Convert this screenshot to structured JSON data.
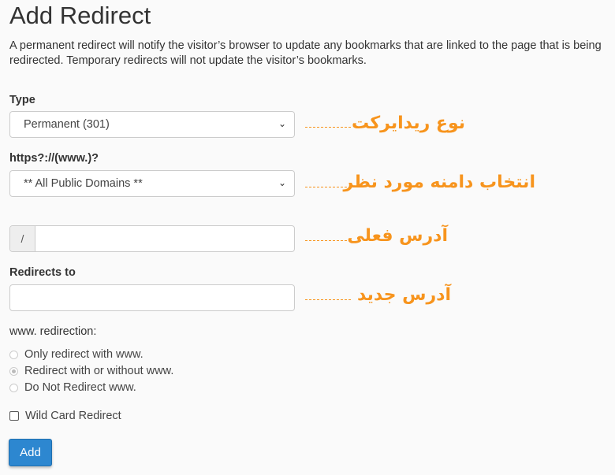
{
  "title": "Add Redirect",
  "description": "A permanent redirect will notify the visitor’s browser to update any bookmarks that are linked to the page that is being redirected. Temporary redirects will not update the visitor’s bookmarks.",
  "type": {
    "label": "Type",
    "value": "Permanent (301)"
  },
  "domain": {
    "label": "https?://(www.)?",
    "value": "** All Public Domains **"
  },
  "path": {
    "prefix": "/",
    "value": ""
  },
  "redirects_to": {
    "label": "Redirects to",
    "value": ""
  },
  "www_redirection": {
    "label": "www. redirection:",
    "options": [
      {
        "label": "Only redirect with www.",
        "selected": false
      },
      {
        "label": "Redirect with or without www.",
        "selected": true
      },
      {
        "label": "Do Not Redirect www.",
        "selected": false
      }
    ]
  },
  "wildcard": {
    "label": "Wild Card Redirect",
    "checked": false
  },
  "add_button": "Add",
  "annotations": {
    "type": "نوع ریدایرکت",
    "domain": "انتخاب دامنه مورد نظر",
    "path": "آدرس فعلی",
    "redirects_to": "آدرس جدید",
    "color": "#f7941d"
  }
}
